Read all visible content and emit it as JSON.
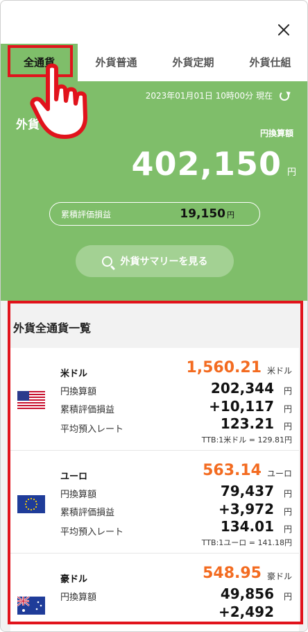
{
  "tabs": [
    "全通貨",
    "外貨普通",
    "外貨定期",
    "外貨仕組"
  ],
  "header": {
    "datetime": "2023年01月01日 10時00分 現在"
  },
  "summary": {
    "label": "外貨",
    "conversion_label": "円換算額",
    "total_amount": "402,150",
    "currency_unit": "円",
    "pl_label": "累積評価損益",
    "pl_value": "19,150",
    "pl_unit": "円",
    "button_label": "外貨サマリーを見る"
  },
  "list": {
    "title": "外貨全通貨一覧",
    "row_labels": {
      "yen_value": "円換算額",
      "pl": "累積評価損益",
      "avg_rate": "平均預入レート"
    },
    "yen_unit": "円",
    "currencies": [
      {
        "name": "米ドル",
        "rate": "1,560.21",
        "unit": "米ドル",
        "yen_value": "202,344",
        "pl": "+10,117",
        "avg_rate": "123.21",
        "ttb": "TTB:1米ドル = 129.81円",
        "flag": "us-flag"
      },
      {
        "name": "ユーロ",
        "rate": "563.14",
        "unit": "ユーロ",
        "yen_value": "79,437",
        "pl": "+3,972",
        "avg_rate": "134.01",
        "ttb": "TTB:1ユーロ = 141.18円",
        "flag": "eu-flag"
      },
      {
        "name": "豪ドル",
        "rate": "548.95",
        "unit": "豪ドル",
        "yen_value": "49,856",
        "pl": "+2,492",
        "avg_rate": "",
        "ttb": "",
        "flag": "au-flag"
      }
    ]
  },
  "colors": {
    "accent_green": "#7fbe6a",
    "rate_orange": "#f36b20",
    "highlight_red": "#e1131c"
  }
}
